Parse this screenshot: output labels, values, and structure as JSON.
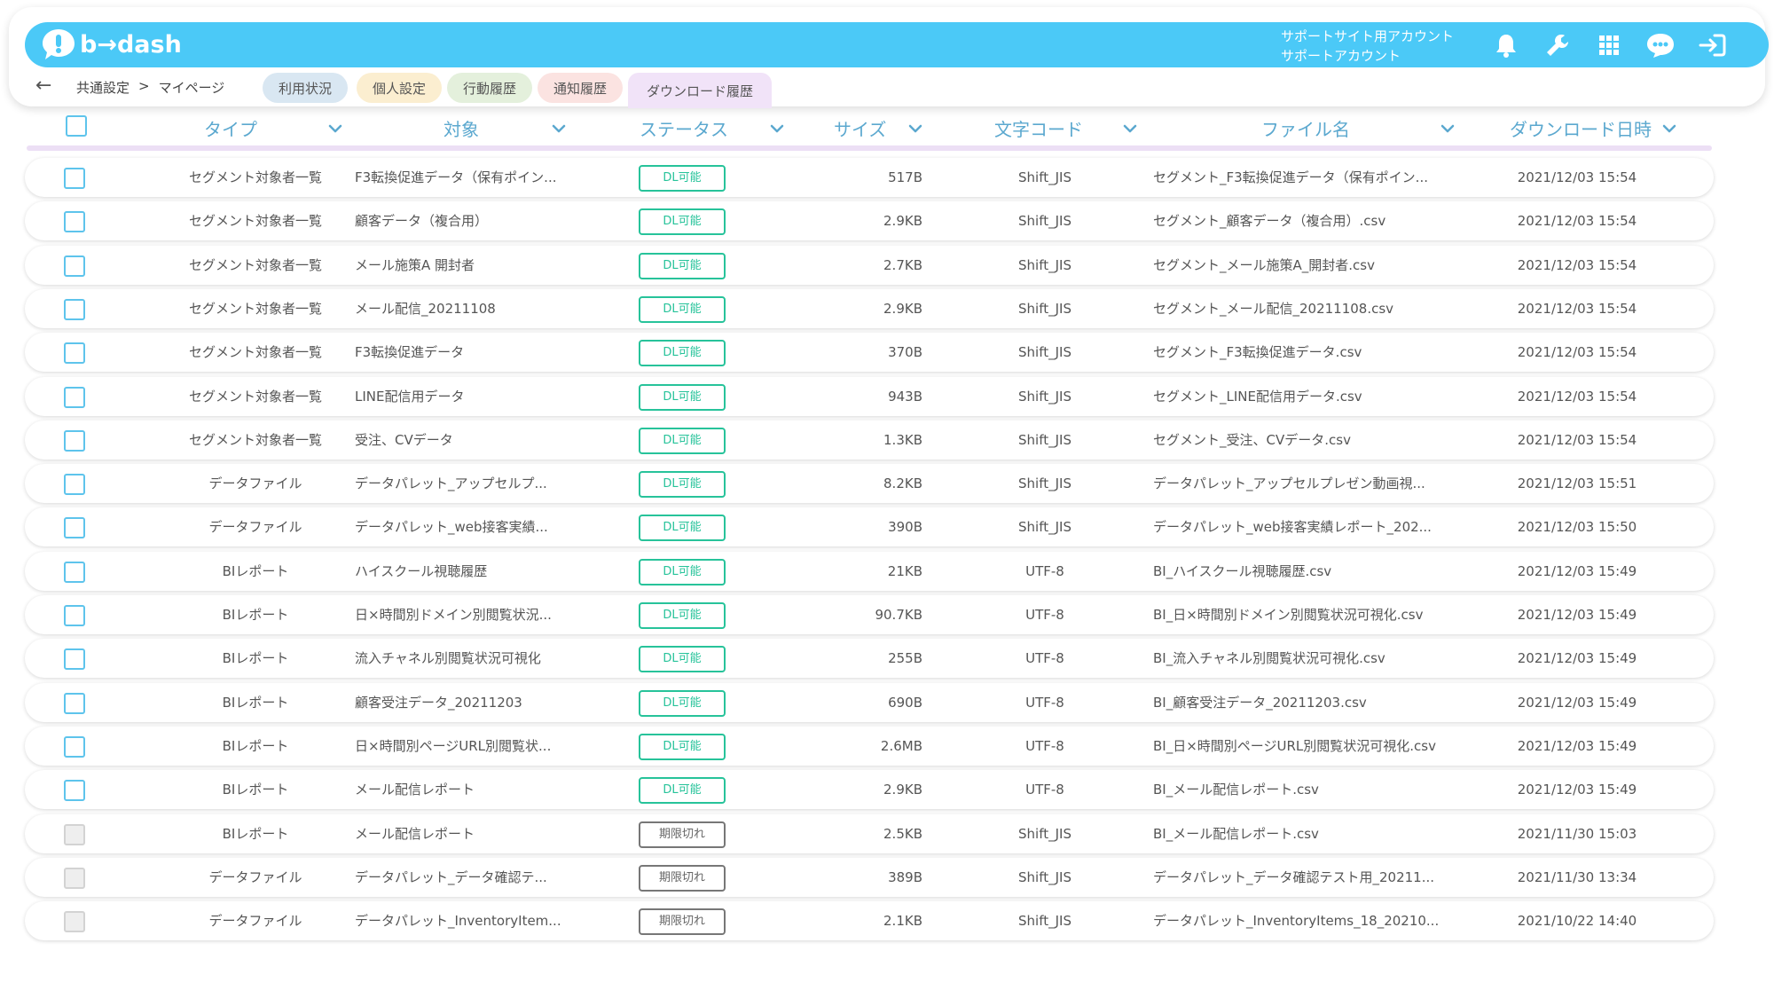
{
  "app": {
    "logo_text": "b→dash",
    "account_line1": "サポートサイト用アカウント",
    "account_line2": "サポートアカウント"
  },
  "colors": {
    "brand": "#4bc9f7",
    "header_text": "#5ba8cf",
    "status_ok": "#27c39a",
    "status_expired": "#777777"
  },
  "icons": [
    "bell-icon",
    "wrench-icon",
    "grid-icon",
    "chat-bubble-icon",
    "logout-icon"
  ],
  "breadcrumb": [
    "共通設定",
    ">",
    "マイページ"
  ],
  "tabs": [
    {
      "label": "利用状況",
      "color": "#d9e7f2"
    },
    {
      "label": "個人設定",
      "color": "#fbeed0"
    },
    {
      "label": "行動履歴",
      "color": "#e4f0dc"
    },
    {
      "label": "通知履歴",
      "color": "#fbe3e1"
    },
    {
      "label": "ダウンロード履歴",
      "color": "#f1e3f8",
      "active": true
    }
  ],
  "table": {
    "columns": [
      "タイプ",
      "対象",
      "ステータス",
      "サイズ",
      "文字コード",
      "ファイル名",
      "ダウンロード日時"
    ],
    "rows": [
      {
        "type": "セグメント対象者一覧",
        "target": "F3転換促進データ（保有ポイン...",
        "status": "DL可能",
        "size": "517B",
        "encoding": "Shift_JIS",
        "filename": "セグメント_F3転換促進データ（保有ポイン...",
        "datetime": "2021/12/03 15:54",
        "expired": false
      },
      {
        "type": "セグメント対象者一覧",
        "target": "顧客データ（複合用）",
        "status": "DL可能",
        "size": "2.9KB",
        "encoding": "Shift_JIS",
        "filename": "セグメント_顧客データ（複合用）.csv",
        "datetime": "2021/12/03 15:54",
        "expired": false
      },
      {
        "type": "セグメント対象者一覧",
        "target": "メール施策A 開封者",
        "status": "DL可能",
        "size": "2.7KB",
        "encoding": "Shift_JIS",
        "filename": "セグメント_メール施策A_開封者.csv",
        "datetime": "2021/12/03 15:54",
        "expired": false
      },
      {
        "type": "セグメント対象者一覧",
        "target": "メール配信_20211108",
        "status": "DL可能",
        "size": "2.9KB",
        "encoding": "Shift_JIS",
        "filename": "セグメント_メール配信_20211108.csv",
        "datetime": "2021/12/03 15:54",
        "expired": false
      },
      {
        "type": "セグメント対象者一覧",
        "target": "F3転換促進データ",
        "status": "DL可能",
        "size": "370B",
        "encoding": "Shift_JIS",
        "filename": "セグメント_F3転換促進データ.csv",
        "datetime": "2021/12/03 15:54",
        "expired": false
      },
      {
        "type": "セグメント対象者一覧",
        "target": "LINE配信用データ",
        "status": "DL可能",
        "size": "943B",
        "encoding": "Shift_JIS",
        "filename": "セグメント_LINE配信用データ.csv",
        "datetime": "2021/12/03 15:54",
        "expired": false
      },
      {
        "type": "セグメント対象者一覧",
        "target": "受注、CVデータ",
        "status": "DL可能",
        "size": "1.3KB",
        "encoding": "Shift_JIS",
        "filename": "セグメント_受注、CVデータ.csv",
        "datetime": "2021/12/03 15:54",
        "expired": false
      },
      {
        "type": "データファイル",
        "target": "データパレット_アップセルプ...",
        "status": "DL可能",
        "size": "8.2KB",
        "encoding": "Shift_JIS",
        "filename": "データパレット_アップセルプレゼン動画視...",
        "datetime": "2021/12/03 15:51",
        "expired": false
      },
      {
        "type": "データファイル",
        "target": "データパレット_web接客実績...",
        "status": "DL可能",
        "size": "390B",
        "encoding": "Shift_JIS",
        "filename": "データパレット_web接客実績レポート_202...",
        "datetime": "2021/12/03 15:50",
        "expired": false
      },
      {
        "type": "BIレポート",
        "target": "ハイスクール視聴履歴",
        "status": "DL可能",
        "size": "21KB",
        "encoding": "UTF-8",
        "filename": "BI_ハイスクール視聴履歴.csv",
        "datetime": "2021/12/03 15:49",
        "expired": false
      },
      {
        "type": "BIレポート",
        "target": "日×時間別ドメイン別閲覧状況...",
        "status": "DL可能",
        "size": "90.7KB",
        "encoding": "UTF-8",
        "filename": "BI_日×時間別ドメイン別閲覧状況可視化.csv",
        "datetime": "2021/12/03 15:49",
        "expired": false
      },
      {
        "type": "BIレポート",
        "target": "流入チャネル別閲覧状況可視化",
        "status": "DL可能",
        "size": "255B",
        "encoding": "UTF-8",
        "filename": "BI_流入チャネル別閲覧状況可視化.csv",
        "datetime": "2021/12/03 15:49",
        "expired": false
      },
      {
        "type": "BIレポート",
        "target": "顧客受注データ_20211203",
        "status": "DL可能",
        "size": "690B",
        "encoding": "UTF-8",
        "filename": "BI_顧客受注データ_20211203.csv",
        "datetime": "2021/12/03 15:49",
        "expired": false
      },
      {
        "type": "BIレポート",
        "target": "日×時間別ページURL別閲覧状...",
        "status": "DL可能",
        "size": "2.6MB",
        "encoding": "UTF-8",
        "filename": "BI_日×時間別ページURL別閲覧状況可視化.csv",
        "datetime": "2021/12/03 15:49",
        "expired": false
      },
      {
        "type": "BIレポート",
        "target": "メール配信レポート",
        "status": "DL可能",
        "size": "2.9KB",
        "encoding": "UTF-8",
        "filename": "BI_メール配信レポート.csv",
        "datetime": "2021/12/03 15:49",
        "expired": false
      },
      {
        "type": "BIレポート",
        "target": "メール配信レポート",
        "status": "期限切れ",
        "size": "2.5KB",
        "encoding": "Shift_JIS",
        "filename": "BI_メール配信レポート.csv",
        "datetime": "2021/11/30 15:03",
        "expired": true
      },
      {
        "type": "データファイル",
        "target": "データパレット_データ確認テ...",
        "status": "期限切れ",
        "size": "389B",
        "encoding": "Shift_JIS",
        "filename": "データパレット_データ確認テスト用_20211...",
        "datetime": "2021/11/30 13:34",
        "expired": true
      },
      {
        "type": "データファイル",
        "target": "データパレット_InventoryItem...",
        "status": "期限切れ",
        "size": "2.1KB",
        "encoding": "Shift_JIS",
        "filename": "データパレット_InventoryItems_18_20210...",
        "datetime": "2021/10/22 14:40",
        "expired": true
      }
    ]
  }
}
